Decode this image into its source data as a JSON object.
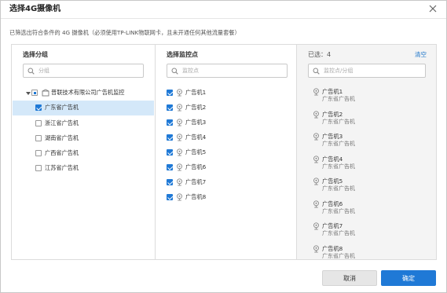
{
  "dialog": {
    "title": "选择4G摄像机",
    "hint": "已筛选出符合条件的 4G 摄像机（必须使用TP-LINK物联网卡，且未开通任何其他流量套餐）"
  },
  "group_panel": {
    "title": "选择分组",
    "search_placeholder": "分组",
    "root": "普联技术有限公司广告机监控",
    "groups": [
      {
        "label": "广东省广告机",
        "checked": true,
        "selected": true
      },
      {
        "label": "浙江省广告机",
        "checked": false
      },
      {
        "label": "湖南省广告机",
        "checked": false
      },
      {
        "label": "广西省广告机",
        "checked": false
      },
      {
        "label": "江苏省广告机",
        "checked": false
      }
    ]
  },
  "monitor_panel": {
    "title": "选择监控点",
    "search_placeholder": "监控点",
    "items": [
      "广告机1",
      "广告机2",
      "广告机3",
      "广告机4",
      "广告机5",
      "广告机6",
      "广告机7",
      "广告机8"
    ]
  },
  "selected_panel": {
    "count_label": "已选：4",
    "clear_label": "清空",
    "search_placeholder": "监控点/分组",
    "items": [
      {
        "name": "广告机1",
        "group": "广东省广告机"
      },
      {
        "name": "广告机2",
        "group": "广东省广告机"
      },
      {
        "name": "广告机3",
        "group": "广东省广告机"
      },
      {
        "name": "广告机4",
        "group": "广东省广告机"
      },
      {
        "name": "广告机5",
        "group": "广东省广告机"
      },
      {
        "name": "广告机6",
        "group": "广东省广告机"
      },
      {
        "name": "广告机7",
        "group": "广东省广告机"
      },
      {
        "name": "广告机8",
        "group": "广东省广告机"
      }
    ]
  },
  "footer": {
    "cancel_label": "取消",
    "ok_label": "确定"
  },
  "colors": {
    "accent": "#1f79d6",
    "selected_row": "#d4e8f9",
    "selected_panel_bg": "#f4f4f4"
  }
}
